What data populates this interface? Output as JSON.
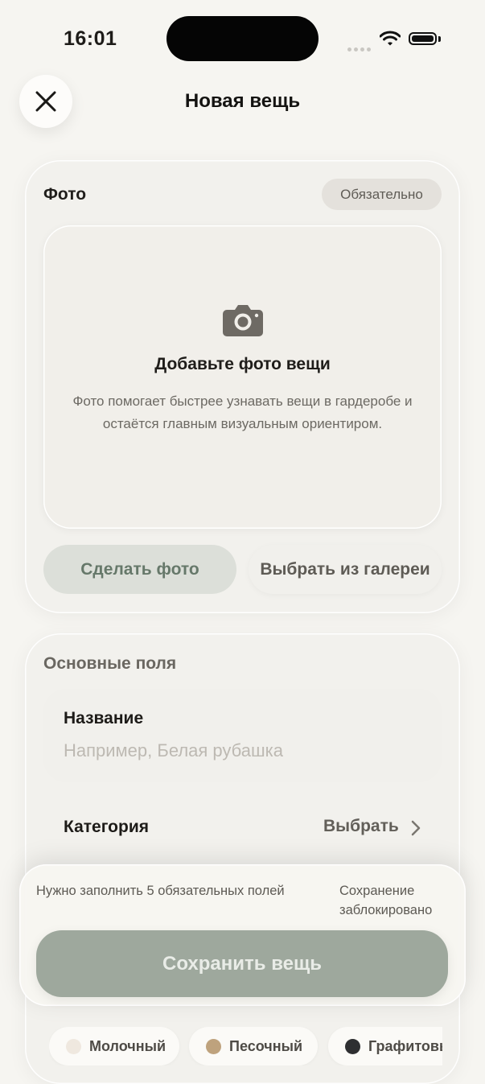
{
  "status_bar": {
    "time": "16:01"
  },
  "header": {
    "title": "Новая вещь",
    "close_icon": "close-icon"
  },
  "photo_section": {
    "label": "Фото",
    "badge": "Обязательно",
    "dropzone_title": "Добавьте фото вещи",
    "dropzone_description": "Фото помогает быстрее узнавать вещи в гардеробе и остаётся главным визуальным ориентиром.",
    "icon": "camera-icon",
    "take_photo_label": "Сделать фото",
    "gallery_label": "Выбрать из галереи"
  },
  "main_fields": {
    "label": "Основные поля",
    "name": {
      "label": "Название",
      "placeholder": "Например, Белая рубашка",
      "value": ""
    },
    "category": {
      "label": "Категория",
      "value": "Выбрать"
    }
  },
  "save_sheet": {
    "required_message": "Нужно заполнить 5 обязательных полей",
    "status_message": "Сохранение заблокировано",
    "save_label": "Сохранить вещь"
  },
  "colors": [
    {
      "label": "Молочный",
      "color": "#efe8df"
    },
    {
      "label": "Песочный",
      "color": "#bea27d"
    },
    {
      "label": "Графитовый",
      "color": "#2e2f31"
    }
  ]
}
